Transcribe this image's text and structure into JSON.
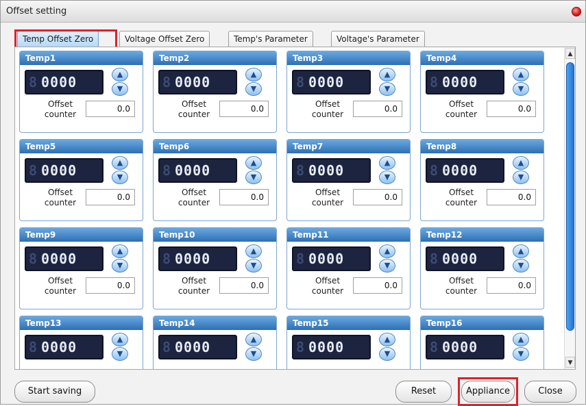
{
  "window": {
    "title": "Offset setting"
  },
  "tabs": [
    {
      "label": "Temp Offset Zero",
      "active": true
    },
    {
      "label": "Voltage Offset Zero",
      "active": false
    },
    {
      "label": "Temp's Parameter",
      "active": false
    },
    {
      "label": "Voltage's Parameter",
      "active": false
    }
  ],
  "cards": [
    {
      "title": "Temp1",
      "display": "0000",
      "label": "Offset counter",
      "value": "0.0"
    },
    {
      "title": "Temp2",
      "display": "0000",
      "label": "Offset counter",
      "value": "0.0"
    },
    {
      "title": "Temp3",
      "display": "0000",
      "label": "Offset counter",
      "value": "0.0"
    },
    {
      "title": "Temp4",
      "display": "0000",
      "label": "Offset counter",
      "value": "0.0"
    },
    {
      "title": "Temp5",
      "display": "0000",
      "label": "Offset counter",
      "value": "0.0"
    },
    {
      "title": "Temp6",
      "display": "0000",
      "label": "Offset counter",
      "value": "0.0"
    },
    {
      "title": "Temp7",
      "display": "0000",
      "label": "Offset counter",
      "value": "0.0"
    },
    {
      "title": "Temp8",
      "display": "0000",
      "label": "Offset counter",
      "value": "0.0"
    },
    {
      "title": "Temp9",
      "display": "0000",
      "label": "Offset counter",
      "value": "0.0"
    },
    {
      "title": "Temp10",
      "display": "0000",
      "label": "Offset counter",
      "value": "0.0"
    },
    {
      "title": "Temp11",
      "display": "0000",
      "label": "Offset counter",
      "value": "0.0"
    },
    {
      "title": "Temp12",
      "display": "0000",
      "label": "Offset counter",
      "value": "0.0"
    },
    {
      "title": "Temp13",
      "display": "0000"
    },
    {
      "title": "Temp14",
      "display": "0000"
    },
    {
      "title": "Temp15",
      "display": "0000"
    },
    {
      "title": "Temp16",
      "display": "0000"
    }
  ],
  "icons": {
    "lcd_prefix": "8",
    "spin_up": "chevron-up-icon",
    "spin_down": "chevron-down-icon",
    "scroll_up": "▲",
    "scroll_down": "▼",
    "up_glyph": "▲",
    "down_glyph": "▼"
  },
  "buttons": {
    "start_saving": "Start saving",
    "reset": "Reset",
    "appliance": "Appliance",
    "close": "Close"
  },
  "colors": {
    "highlight": "#e0202a",
    "card_header": "#2d6fb4",
    "lcd_bg": "#1c2440",
    "scroll_thumb": "#1f75d6"
  }
}
